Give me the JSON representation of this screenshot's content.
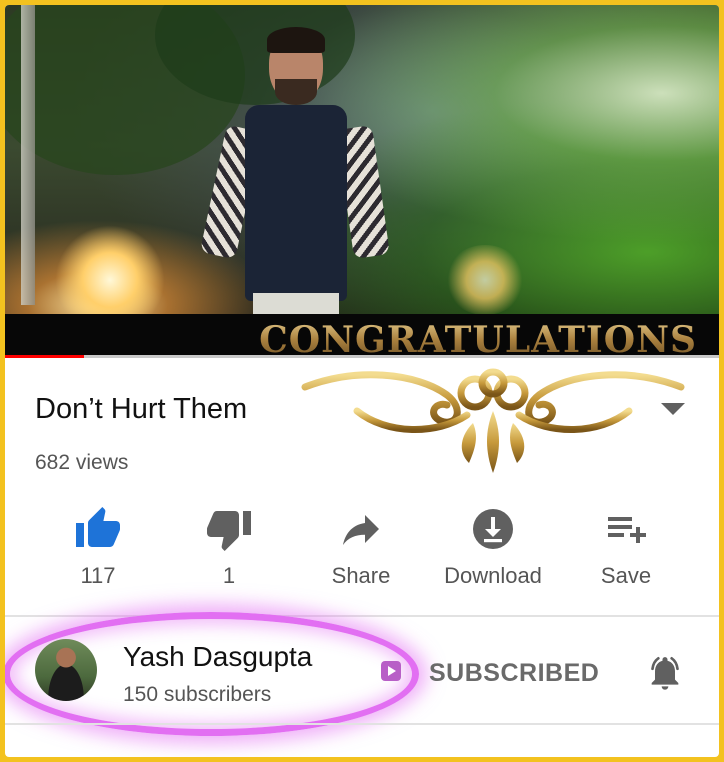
{
  "video": {
    "overlay_text": "CONGRATULATIONS",
    "progress_fraction": 0.11,
    "progress_color": "#ff0000"
  },
  "details": {
    "title": "Don’t Hurt Them",
    "views": "682 views",
    "expand_icon": "chevron-down-icon"
  },
  "actions": [
    {
      "icon": "thumbs-up-icon",
      "label": "117",
      "color": "#1e73d8"
    },
    {
      "icon": "thumbs-down-icon",
      "label": "1",
      "color": "#606060"
    },
    {
      "icon": "share-icon",
      "label": "Share",
      "color": "#606060"
    },
    {
      "icon": "download-icon",
      "label": "Download",
      "color": "#606060"
    },
    {
      "icon": "add-to-playlist-icon",
      "label": "Save",
      "color": "#606060"
    }
  ],
  "channel": {
    "name": "Yash Dasgupta",
    "subscribers": "150 subscribers",
    "subscribe_state": "SUBSCRIBED",
    "bell_icon": "notification-bell-icon",
    "highlight_color": "#e26ff2"
  },
  "colors": {
    "frame_border": "#f3c21f",
    "text_primary": "#111111",
    "text_secondary": "#555555"
  }
}
